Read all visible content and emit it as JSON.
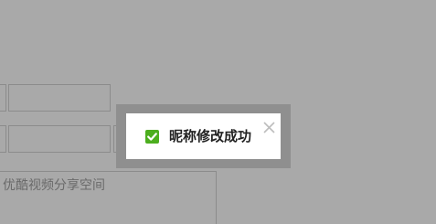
{
  "form": {
    "textarea_value": "优酷视频分享空间"
  },
  "toast": {
    "message": "昵称修改成功",
    "status_icon": "check-icon",
    "close_icon": "close-icon",
    "accent_color": "#4cae1e"
  }
}
